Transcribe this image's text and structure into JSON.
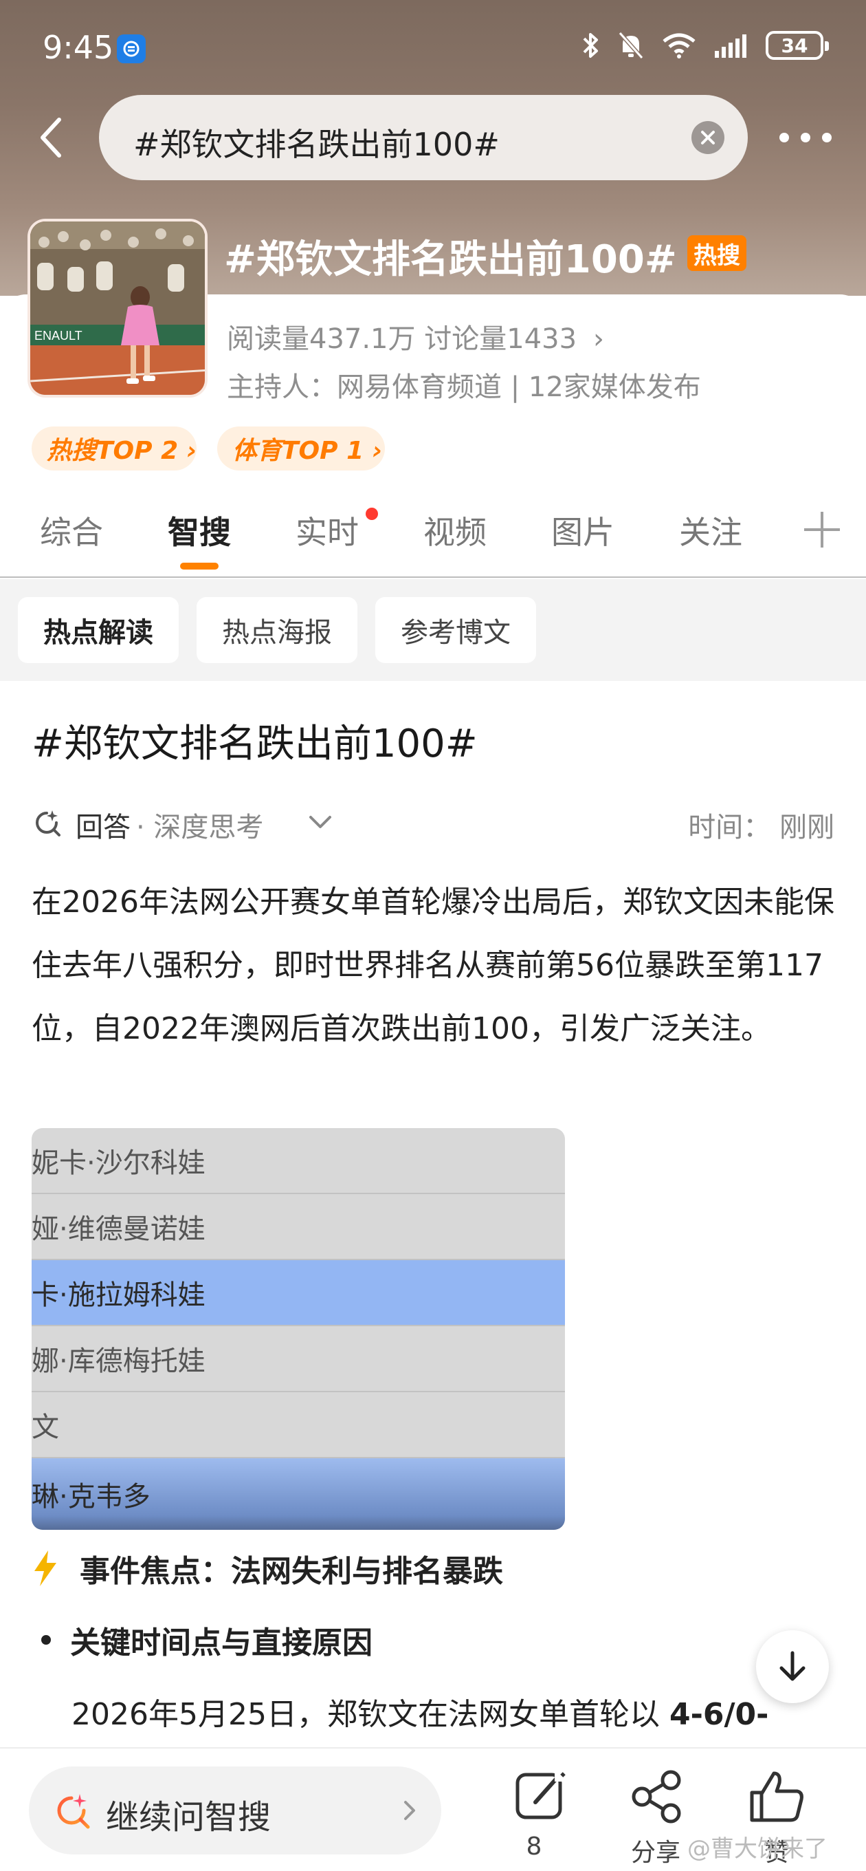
{
  "status_bar": {
    "time": "9:45",
    "battery": "34"
  },
  "search": {
    "query": "#郑钦文排名跌出前100#"
  },
  "topic": {
    "title": "#郑钦文排名跌出前100#",
    "hot_badge": "热搜",
    "stats": "阅读量437.1万  讨论量1433",
    "stats_arrow": "›",
    "host": "主持人：网易体育频道 | 12家媒体发布",
    "rank_tags": [
      "热搜TOP 2 ›",
      "体育TOP 1 ›"
    ]
  },
  "tabs": [
    {
      "label": "综合"
    },
    {
      "label": "智搜"
    },
    {
      "label": "实时"
    },
    {
      "label": "视频"
    },
    {
      "label": "图片"
    },
    {
      "label": "关注"
    }
  ],
  "sub_tabs": [
    {
      "label": "热点解读"
    },
    {
      "label": "热点海报"
    },
    {
      "label": "参考博文"
    }
  ],
  "content": {
    "title": "#郑钦文排名跌出前100#",
    "answer_label": "回答",
    "answer_mode": "· 深度思考",
    "time": "时间：  刚刚",
    "paragraph": "在2026年法网公开赛女单首轮爆冷出局后，郑钦文因未能保住去年八强积分，即时世界排名从赛前第56位暴跌至第117位，自2022年澳网后首次跌出前100，引发广泛关注。",
    "table_rows": [
      "妮卡·沙尔科娃",
      "娅·维德曼诺娃",
      "卡·施拉姆科娃",
      "娜·库德梅托娃",
      "文",
      "琳·克韦多"
    ],
    "focus_title": "事件焦点：法网失利与排名暴跌",
    "bullet_title": "关键时间点与直接原因",
    "detail_prefix": "2026年5月25日，郑钦文在法网女单首轮以 ",
    "detail_bold": "4-6/0-"
  },
  "bottom_bar": {
    "ask_placeholder": "继续问智搜",
    "comment_count": "8",
    "share_label": "分享",
    "like_label": "赞",
    "watermark": "@曹大饼来了"
  },
  "colors": {
    "accent": "#ff8200",
    "hot_badge": "#ff8000",
    "highlight_row": "#93b6f3"
  }
}
